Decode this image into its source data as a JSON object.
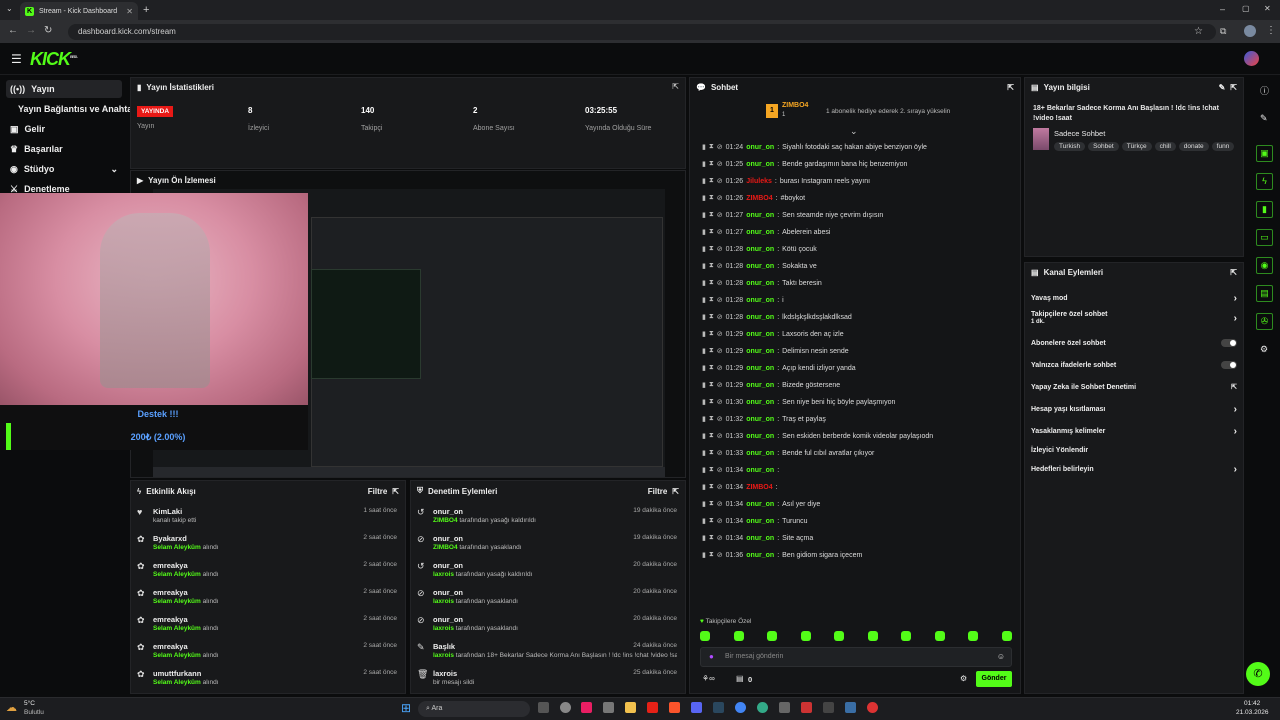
{
  "browser": {
    "tab_title": "Stream - Kick Dashboard",
    "url": "dashboard.kick.com/stream"
  },
  "logo": "KICK",
  "logo_beta": "BETA",
  "sidebar": {
    "items": [
      {
        "label": "Yayın"
      },
      {
        "label": "Yayın Bağlantısı ve Anahtarı"
      },
      {
        "label": "Gelir"
      },
      {
        "label": "Başarılar"
      },
      {
        "label": "Stüdyo"
      },
      {
        "label": "Denetleme"
      }
    ]
  },
  "stats": {
    "title": "Yayın İstatistikleri",
    "live_badge": "YAYINDA",
    "live_label": "Yayın",
    "viewers": "8",
    "viewers_label": "İzleyici",
    "followers": "140",
    "followers_label": "Takipçi",
    "subs": "2",
    "subs_label": "Abone Sayısı",
    "uptime": "03:25:55",
    "uptime_label": "Yayında Olduğu Süre"
  },
  "preview": {
    "title": "Yayın Ön İzlemesi",
    "overlay_title": "Destek !!!",
    "overlay_amount": "200₺ (2.00%)"
  },
  "activity": {
    "title": "Etkinlik Akışı",
    "filter": "Filtre",
    "rows": [
      {
        "name": "KimLaki",
        "sub": "kanalı takip etti",
        "hl": "",
        "time": "1 saat önce",
        "icon": "♥"
      },
      {
        "name": "Byakarxd",
        "hl": "Selam Aleyküm",
        "sub": " alındı",
        "time": "2 saat önce",
        "icon": "✿"
      },
      {
        "name": "emreakya",
        "hl": "Selam Aleyküm",
        "sub": " alındı",
        "time": "2 saat önce",
        "icon": "✿"
      },
      {
        "name": "emreakya",
        "hl": "Selam Aleyküm",
        "sub": " alındı",
        "time": "2 saat önce",
        "icon": "✿"
      },
      {
        "name": "emreakya",
        "hl": "Selam Aleyküm",
        "sub": " alındı",
        "time": "2 saat önce",
        "icon": "✿"
      },
      {
        "name": "emreakya",
        "hl": "Selam Aleyküm",
        "sub": " alındı",
        "time": "2 saat önce",
        "icon": "✿"
      },
      {
        "name": "umuttfurkann",
        "hl": "Selam Aleyküm",
        "sub": " alındı",
        "time": "2 saat önce",
        "icon": "✿"
      }
    ]
  },
  "moderation": {
    "title": "Denetim Eylemleri",
    "filter": "Filtre",
    "rows": [
      {
        "name": "onur_on",
        "hl": "ZIMBO4",
        "sub": " tarafından yasağı kaldırıldı",
        "time": "19 dakika önce",
        "icon": "↺"
      },
      {
        "name": "onur_on",
        "hl": "ZIMBO4",
        "sub": " tarafından yasaklandı",
        "time": "19 dakika önce",
        "icon": "⊘"
      },
      {
        "name": "onur_on",
        "hl": "laxrois",
        "sub": " tarafından yasağı kaldırıldı",
        "time": "20 dakika önce",
        "icon": "↺"
      },
      {
        "name": "onur_on",
        "hl": "laxrois",
        "sub": " tarafından yasaklandı",
        "time": "20 dakika önce",
        "icon": "⊘"
      },
      {
        "name": "onur_on",
        "hl": "laxrois",
        "sub": " tarafından yasaklandı",
        "time": "20 dakika önce",
        "icon": "⊘"
      },
      {
        "name": "Başlık",
        "hl": "laxrois",
        "sub": " tarafından 18+ Bekarlar Sadece Korma Anı Başlasın ! !dc !ins !chat !video !saat olarak değiştirildi",
        "time": "24 dakika önce",
        "icon": "✎"
      },
      {
        "name": "laxrois",
        "hl": "",
        "sub": "bir mesajı sildi",
        "time": "25 dakika önce",
        "icon": "🗑"
      }
    ]
  },
  "chat": {
    "title": "Sohbet",
    "pinned_user": "ZIMBO4",
    "pinned_count": "1",
    "pinned_text": "1 abonelik hediye ederek 2. sıraya yükselin",
    "messages": [
      {
        "time": "01:24",
        "user": "onur_on",
        "text": "Siyahlı fotodaki saç hakan abiye benziyon öyle",
        "red": false
      },
      {
        "time": "01:25",
        "user": "onur_on",
        "text": "Bende gardaşımın bana hiç benzemiyon",
        "red": false
      },
      {
        "time": "01:26",
        "user": "Jiluleks",
        "text": "burası Instagram reels yayını",
        "red": true
      },
      {
        "time": "01:26",
        "user": "ZIMBO4",
        "text": "#boykot",
        "red": true
      },
      {
        "time": "01:27",
        "user": "onur_on",
        "text": "Sen steamde niye çevrim dışısın",
        "red": false
      },
      {
        "time": "01:27",
        "user": "onur_on",
        "text": "Abelerein abesi",
        "red": false
      },
      {
        "time": "01:28",
        "user": "onur_on",
        "text": "Kötü çocuk",
        "red": false
      },
      {
        "time": "01:28",
        "user": "onur_on",
        "text": "Sokakta ve",
        "red": false
      },
      {
        "time": "01:28",
        "user": "onur_on",
        "text": "Taktı beresin",
        "red": false
      },
      {
        "time": "01:28",
        "user": "onur_on",
        "text": "i",
        "red": false
      },
      {
        "time": "01:28",
        "user": "onur_on",
        "text": "lkdslşkşlkdsşlakdlksad",
        "red": false
      },
      {
        "time": "01:29",
        "user": "onur_on",
        "text": "Laxsoris den aç izle",
        "red": false
      },
      {
        "time": "01:29",
        "user": "onur_on",
        "text": "Delimisn nesin sende",
        "red": false
      },
      {
        "time": "01:29",
        "user": "onur_on",
        "text": "Açıp kendi izliyor yanda",
        "red": false
      },
      {
        "time": "01:29",
        "user": "onur_on",
        "text": "Bizede göstersene",
        "red": false
      },
      {
        "time": "01:30",
        "user": "onur_on",
        "text": "Sen niye beni hiç böyle paylaşmıyon",
        "red": false
      },
      {
        "time": "01:32",
        "user": "onur_on",
        "text": "Traş et paylaş",
        "red": false
      },
      {
        "time": "01:33",
        "user": "onur_on",
        "text": "Sen eskiden berberde komik videolar paylaşıodn",
        "red": false
      },
      {
        "time": "01:33",
        "user": "onur_on",
        "text": "Bende ful cıbıl avratlar çıkıyor",
        "red": false
      },
      {
        "time": "01:34",
        "user": "onur_on",
        "text": "",
        "red": false
      },
      {
        "time": "01:34",
        "user": "ZIMBO4",
        "text": "",
        "red": true
      },
      {
        "time": "01:34",
        "user": "onur_on",
        "text": "Asıl yer diye",
        "red": false
      },
      {
        "time": "01:34",
        "user": "onur_on",
        "text": "Turuncu",
        "red": false
      },
      {
        "time": "01:34",
        "user": "onur_on",
        "text": "Site açma",
        "red": false
      },
      {
        "time": "01:36",
        "user": "onur_on",
        "text": "Ben gidiom sigara içecem",
        "red": false
      }
    ],
    "followers_only": "Takipçilere Özel",
    "input_placeholder": "Bir mesaj gönderin",
    "count": "0",
    "send": "Gönder"
  },
  "stream_info": {
    "title": "Yayın bilgisi",
    "stream_title": "18+ Bekarlar Sadece Korma Anı Başlasın ! !dc !ins !chat !video !saat",
    "category": "Sadece Sohbet",
    "tags": [
      "Turkish",
      "Sohbet",
      "Türkçe",
      "chill",
      "donate",
      "funn"
    ]
  },
  "channel_actions": {
    "title": "Kanal Eylemleri",
    "items": [
      {
        "label": "Yavaş mod",
        "sub": "",
        "ctrl": "chev"
      },
      {
        "label": "Takipçilere özel sohbet",
        "sub": "1 dk.",
        "ctrl": "chev"
      },
      {
        "label": "Abonelere özel sohbet",
        "sub": "",
        "ctrl": "toggle"
      },
      {
        "label": "Yalnızca ifadelerle sohbet",
        "sub": "",
        "ctrl": "toggle"
      },
      {
        "label": "Yapay Zeka ile Sohbet Denetimi",
        "sub": "",
        "ctrl": "ext"
      },
      {
        "label": "Hesap yaşı kısıtlaması",
        "sub": "",
        "ctrl": "chev"
      },
      {
        "label": "Yasaklanmış kelimeler",
        "sub": "",
        "ctrl": "chev"
      },
      {
        "label": "İzleyici Yönlendir",
        "sub": "",
        "ctrl": ""
      },
      {
        "label": "Hedefleri belirleyin",
        "sub": "",
        "ctrl": "chev"
      }
    ]
  },
  "taskbar": {
    "weather_temp": "5°C",
    "weather_desc": "Bulutlu",
    "search": "Ara",
    "time": "01:42",
    "date": "21.03.2026"
  },
  "colors": {
    "accent": "#53fc18",
    "live": "#e91916",
    "bg": "#0b0c0d",
    "panel": "#18191b"
  }
}
